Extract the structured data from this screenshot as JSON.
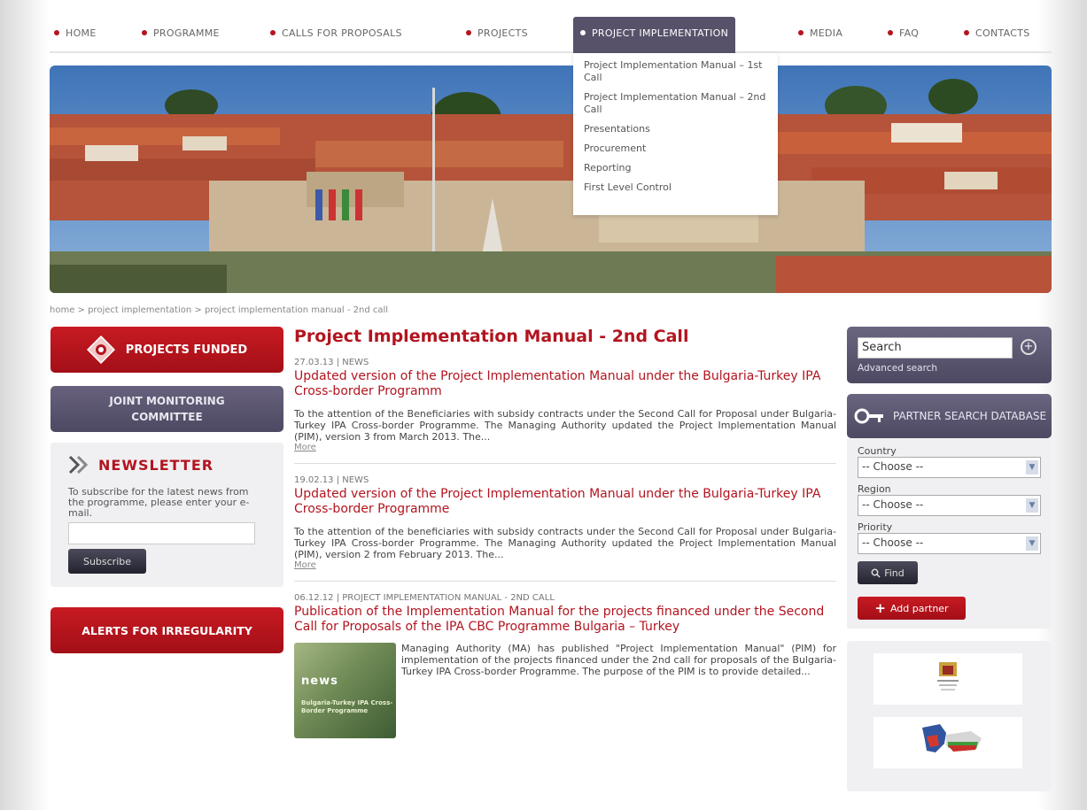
{
  "nav": {
    "items": [
      {
        "label": "HOME"
      },
      {
        "label": "PROGRAMME"
      },
      {
        "label": "CALLS FOR PROPOSALS"
      },
      {
        "label": "PROJECTS"
      },
      {
        "label": "PROJECT IMPLEMENTATION"
      },
      {
        "label": "MEDIA"
      },
      {
        "label": "FAQ"
      },
      {
        "label": "CONTACTS"
      }
    ],
    "dropdown": [
      "Project Implementation Manual – 1st Call",
      "Project Implementation Manual – 2nd Call",
      "Presentations",
      "Procurement",
      "Reporting",
      "First Level Control"
    ]
  },
  "breadcrumb": "home > project implementation > project implementation manual - 2nd call",
  "left": {
    "projects_funded": "PROJECTS FUNDED",
    "joint_monitoring": "JOINT MONITORING COMMITTEE",
    "newsletter_title": "NEWSLETTER",
    "newsletter_text": "To subscribe for the latest news from the programme, please enter your e-mail.",
    "newsletter_input": "",
    "subscribe": "Subscribe",
    "alerts": "ALERTS FOR IRREGULARITY"
  },
  "main": {
    "title": "Project Implementation Manual - 2nd Call",
    "articles": [
      {
        "meta": "27.03.13 | NEWS",
        "title": "Updated version of the Project Implementation Manual under the Bulgaria-Turkey IPA Cross-border Programm",
        "text": "To the attention of the Beneficiaries with subsidy contracts under the Second Call for Proposal under Bulgaria-Turkey IPA Cross-border Programme. The Managing Authority updated the Project Implementation Manual (PIM), version 3 from March 2013. The...",
        "more": "More"
      },
      {
        "meta": "19.02.13 | NEWS",
        "title": "Updated version of the Project Implementation Manual under the Bulgaria-Turkey IPA Cross-border Programme",
        "text": "To the attention of the beneficiaries with subsidy contracts under the Second Call for Proposal under Bulgaria-Turkey IPA Cross-border Programme. The Managing Authority updated the Project Implementation Manual (PIM), version 2 from February 2013. The...",
        "more": "More"
      },
      {
        "meta": "06.12.12 | PROJECT IMPLEMENTATION MANUAL - 2ND CALL",
        "title": "Publication of the Implementation Manual for the projects financed under the Second Call for Proposals of the IPA CBC Programme Bulgaria – Turkey",
        "text": "Managing Authority (MA) has published \"Project Implementation Manual\" (PIM) for implementation of the projects financed under the 2nd call for proposals of the Bulgaria-Turkey IPA Cross-border Programme. The purpose of the PIM is to provide detailed...",
        "image_word": "news",
        "image_caption": "Bulgaria-Turkey IPA Cross-Border Programme"
      }
    ]
  },
  "right": {
    "search_value": "Search",
    "advanced": "Advanced search",
    "partner_title": "PARTNER SEARCH DATABASE",
    "country_label": "Country",
    "country_value": "-- Choose --",
    "region_label": "Region",
    "region_value": "-- Choose --",
    "priority_label": "Priority",
    "priority_value": "-- Choose --",
    "find": "Find",
    "add_partner": "Add partner"
  },
  "colors": {
    "brand_red": "#b3141f",
    "nav_active": "#57526a",
    "panel_bg": "#f0f0f2"
  }
}
